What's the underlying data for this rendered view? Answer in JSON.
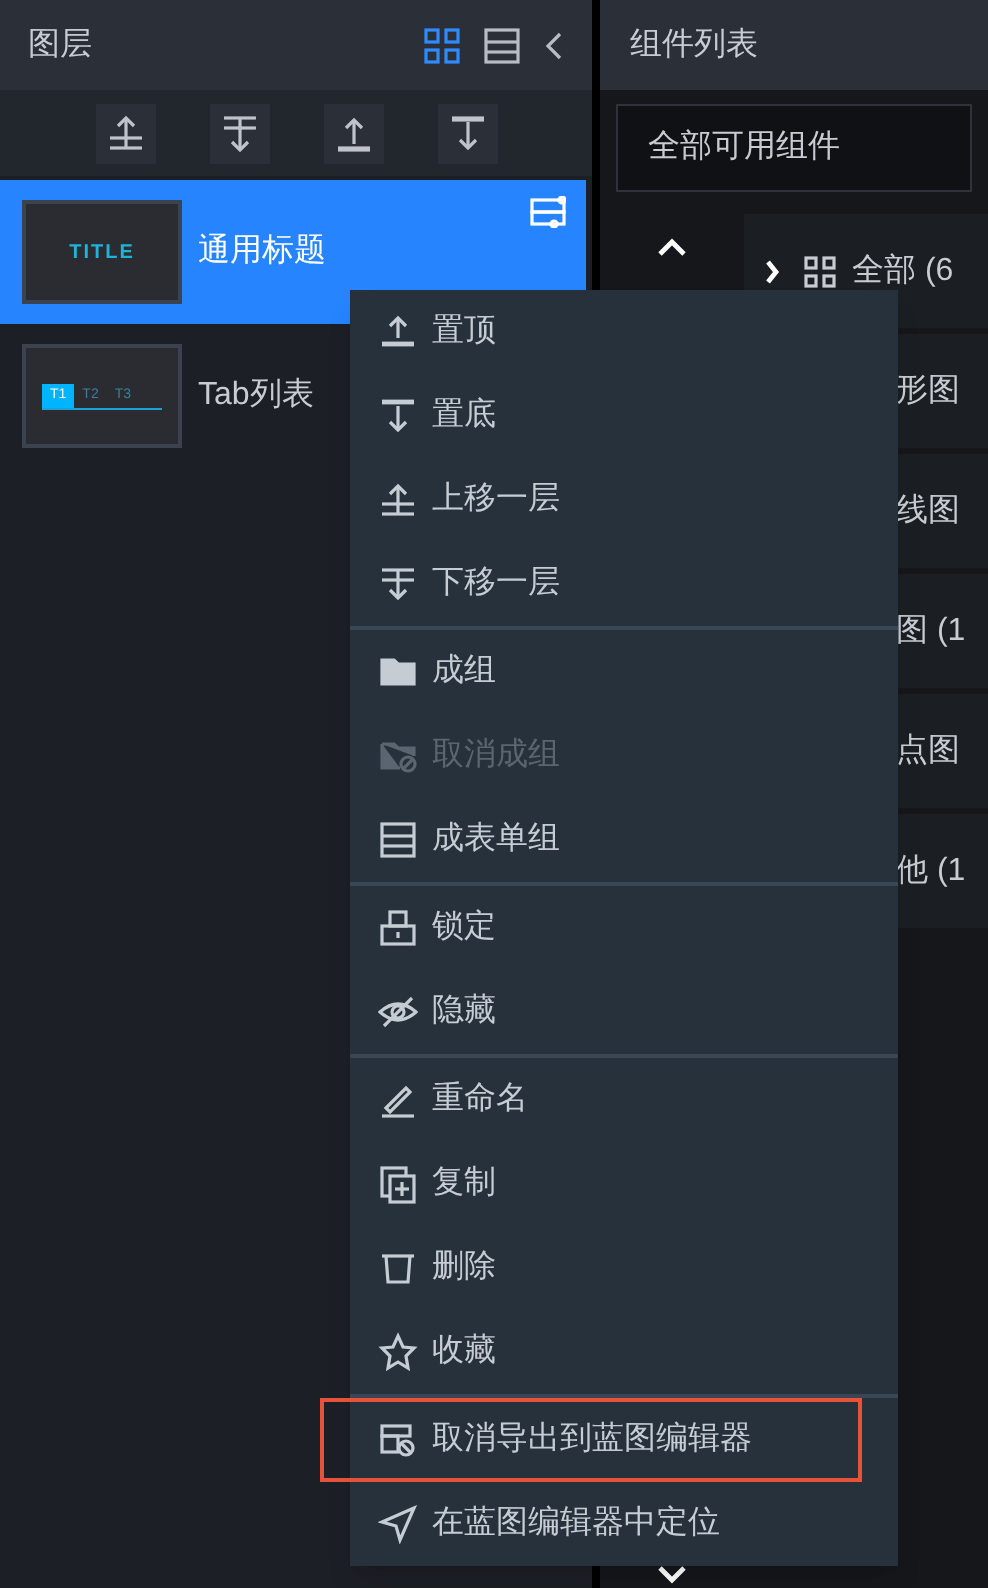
{
  "layers_panel": {
    "title": "图层",
    "view_modes": [
      {
        "selected": true
      },
      {
        "selected": false
      }
    ],
    "layers": [
      {
        "name": "通用标题",
        "thumb_text": "TITLE",
        "selected": true
      },
      {
        "name": "Tab列表",
        "thumb_tabs": [
          "T1",
          "T2",
          "T3"
        ],
        "selected": false
      }
    ]
  },
  "components_panel": {
    "title": "组件列表",
    "filter": "全部可用组件",
    "categories": [
      "全部 (6",
      "形图",
      "线图",
      "图 (1",
      "点图",
      "他 (1"
    ]
  },
  "context_menu": {
    "groups": [
      [
        {
          "label": "置顶",
          "disabled": false,
          "highlighted": false
        },
        {
          "label": "置底",
          "disabled": false,
          "highlighted": false
        },
        {
          "label": "上移一层",
          "disabled": false,
          "highlighted": false
        },
        {
          "label": "下移一层",
          "disabled": false,
          "highlighted": false
        }
      ],
      [
        {
          "label": "成组",
          "disabled": false,
          "highlighted": false
        },
        {
          "label": "取消成组",
          "disabled": true,
          "highlighted": false
        },
        {
          "label": "成表单组",
          "disabled": false,
          "highlighted": false
        }
      ],
      [
        {
          "label": "锁定",
          "disabled": false,
          "highlighted": false
        },
        {
          "label": "隐藏",
          "disabled": false,
          "highlighted": false
        }
      ],
      [
        {
          "label": "重命名",
          "disabled": false,
          "highlighted": false
        },
        {
          "label": "复制",
          "disabled": false,
          "highlighted": false
        },
        {
          "label": "删除",
          "disabled": false,
          "highlighted": false
        },
        {
          "label": "收藏",
          "disabled": false,
          "highlighted": false
        }
      ],
      [
        {
          "label": "取消导出到蓝图编辑器",
          "disabled": false,
          "highlighted": true
        },
        {
          "label": "在蓝图编辑器中定位",
          "disabled": false,
          "highlighted": false
        }
      ]
    ]
  }
}
